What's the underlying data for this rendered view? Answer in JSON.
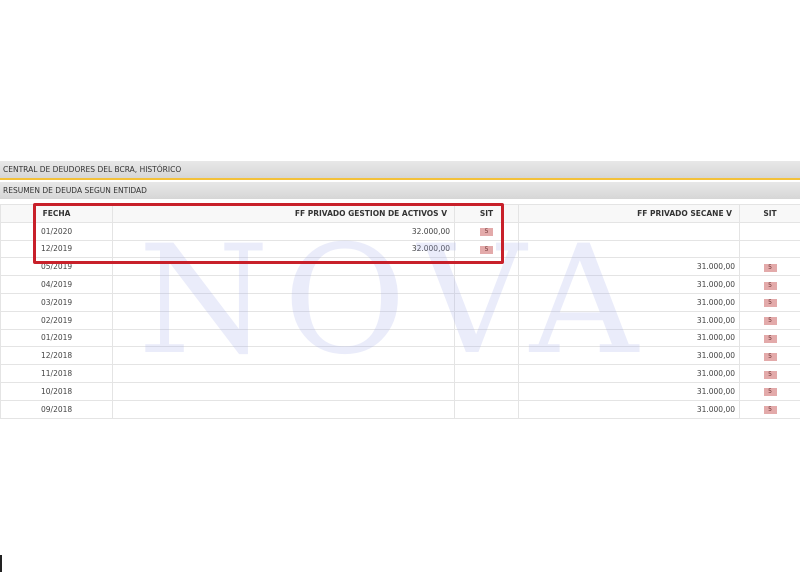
{
  "headers": {
    "section_title": "CENTRAL DE DEUDORES DEL BCRA, HISTÓRICO",
    "subsection_title": "RESUMEN DE DEUDA SEGUN ENTIDAD"
  },
  "table": {
    "columns": {
      "fecha": "FECHA",
      "entity1": "FF PRIVADO GESTION DE ACTIVOS V",
      "sit1": "SIT",
      "entity2": "FF PRIVADO SECANE V",
      "sit2": "SIT"
    },
    "rows": [
      {
        "fecha": "01/2020",
        "amount1": "32.000,00",
        "sit1": "5",
        "amount2": "",
        "sit2": ""
      },
      {
        "fecha": "12/2019",
        "amount1": "32.000,00",
        "sit1": "5",
        "amount2": "",
        "sit2": ""
      },
      {
        "fecha": "05/2019",
        "amount1": "",
        "sit1": "",
        "amount2": "31.000,00",
        "sit2": "5"
      },
      {
        "fecha": "04/2019",
        "amount1": "",
        "sit1": "",
        "amount2": "31.000,00",
        "sit2": "5"
      },
      {
        "fecha": "03/2019",
        "amount1": "",
        "sit1": "",
        "amount2": "31.000,00",
        "sit2": "5"
      },
      {
        "fecha": "02/2019",
        "amount1": "",
        "sit1": "",
        "amount2": "31.000,00",
        "sit2": "5"
      },
      {
        "fecha": "01/2019",
        "amount1": "",
        "sit1": "",
        "amount2": "31.000,00",
        "sit2": "5"
      },
      {
        "fecha": "12/2018",
        "amount1": "",
        "sit1": "",
        "amount2": "31.000,00",
        "sit2": "5"
      },
      {
        "fecha": "11/2018",
        "amount1": "",
        "sit1": "",
        "amount2": "31.000,00",
        "sit2": "5"
      },
      {
        "fecha": "10/2018",
        "amount1": "",
        "sit1": "",
        "amount2": "31.000,00",
        "sit2": "5"
      },
      {
        "fecha": "09/2018",
        "amount1": "",
        "sit1": "",
        "amount2": "31.000,00",
        "sit2": "5"
      }
    ]
  },
  "watermark": "NOVA",
  "colors": {
    "highlight_box": "#c8202a",
    "badge": "#e3aaaa",
    "accent_line": "#f3c13a"
  }
}
